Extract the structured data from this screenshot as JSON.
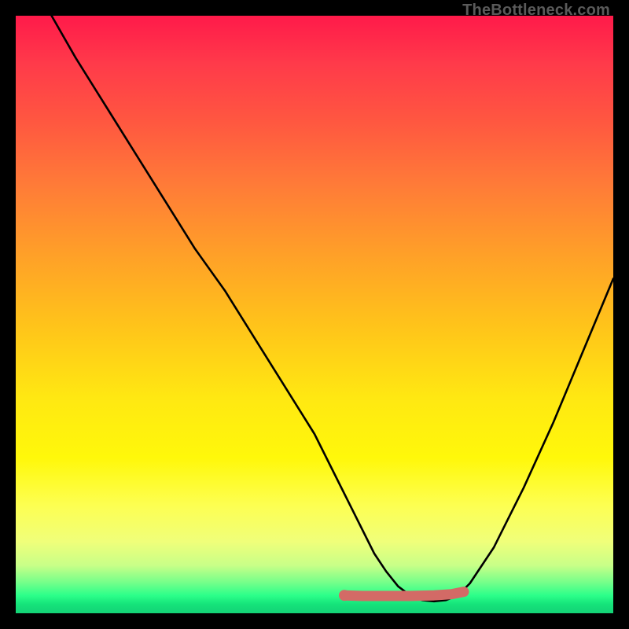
{
  "watermark": "TheBottleneck.com",
  "colors": {
    "frame": "#000000",
    "gradient_top": "#ff1a4a",
    "gradient_mid": "#ffe812",
    "gradient_bottom": "#14d276",
    "curve": "#000000",
    "marker_stroke": "#d36a66",
    "marker_fill": "#d36a66"
  },
  "chart_data": {
    "type": "line",
    "title": "",
    "xlabel": "",
    "ylabel": "",
    "xlim": [
      0,
      100
    ],
    "ylim": [
      0,
      100
    ],
    "series": [
      {
        "name": "bottleneck-curve",
        "x": [
          6,
          10,
          15,
          20,
          25,
          30,
          35,
          40,
          45,
          50,
          52.5,
          55,
          57.5,
          60,
          62,
          64,
          66,
          68,
          70,
          72,
          74,
          76,
          80,
          85,
          90,
          95,
          100
        ],
        "y": [
          100,
          93,
          85,
          77,
          69,
          61,
          54,
          46,
          38,
          30,
          25,
          20,
          15,
          10,
          7,
          4.5,
          3,
          2.2,
          2,
          2.2,
          3,
          5,
          11,
          21,
          32,
          44,
          56
        ]
      }
    ],
    "markers": {
      "name": "highlight-segment",
      "x": [
        55,
        58,
        62,
        66,
        70,
        73,
        75
      ],
      "y": [
        3.0,
        2.9,
        2.9,
        2.9,
        3.0,
        3.2,
        3.6
      ]
    },
    "marker_dot": {
      "x": 55,
      "y": 3.0
    }
  }
}
